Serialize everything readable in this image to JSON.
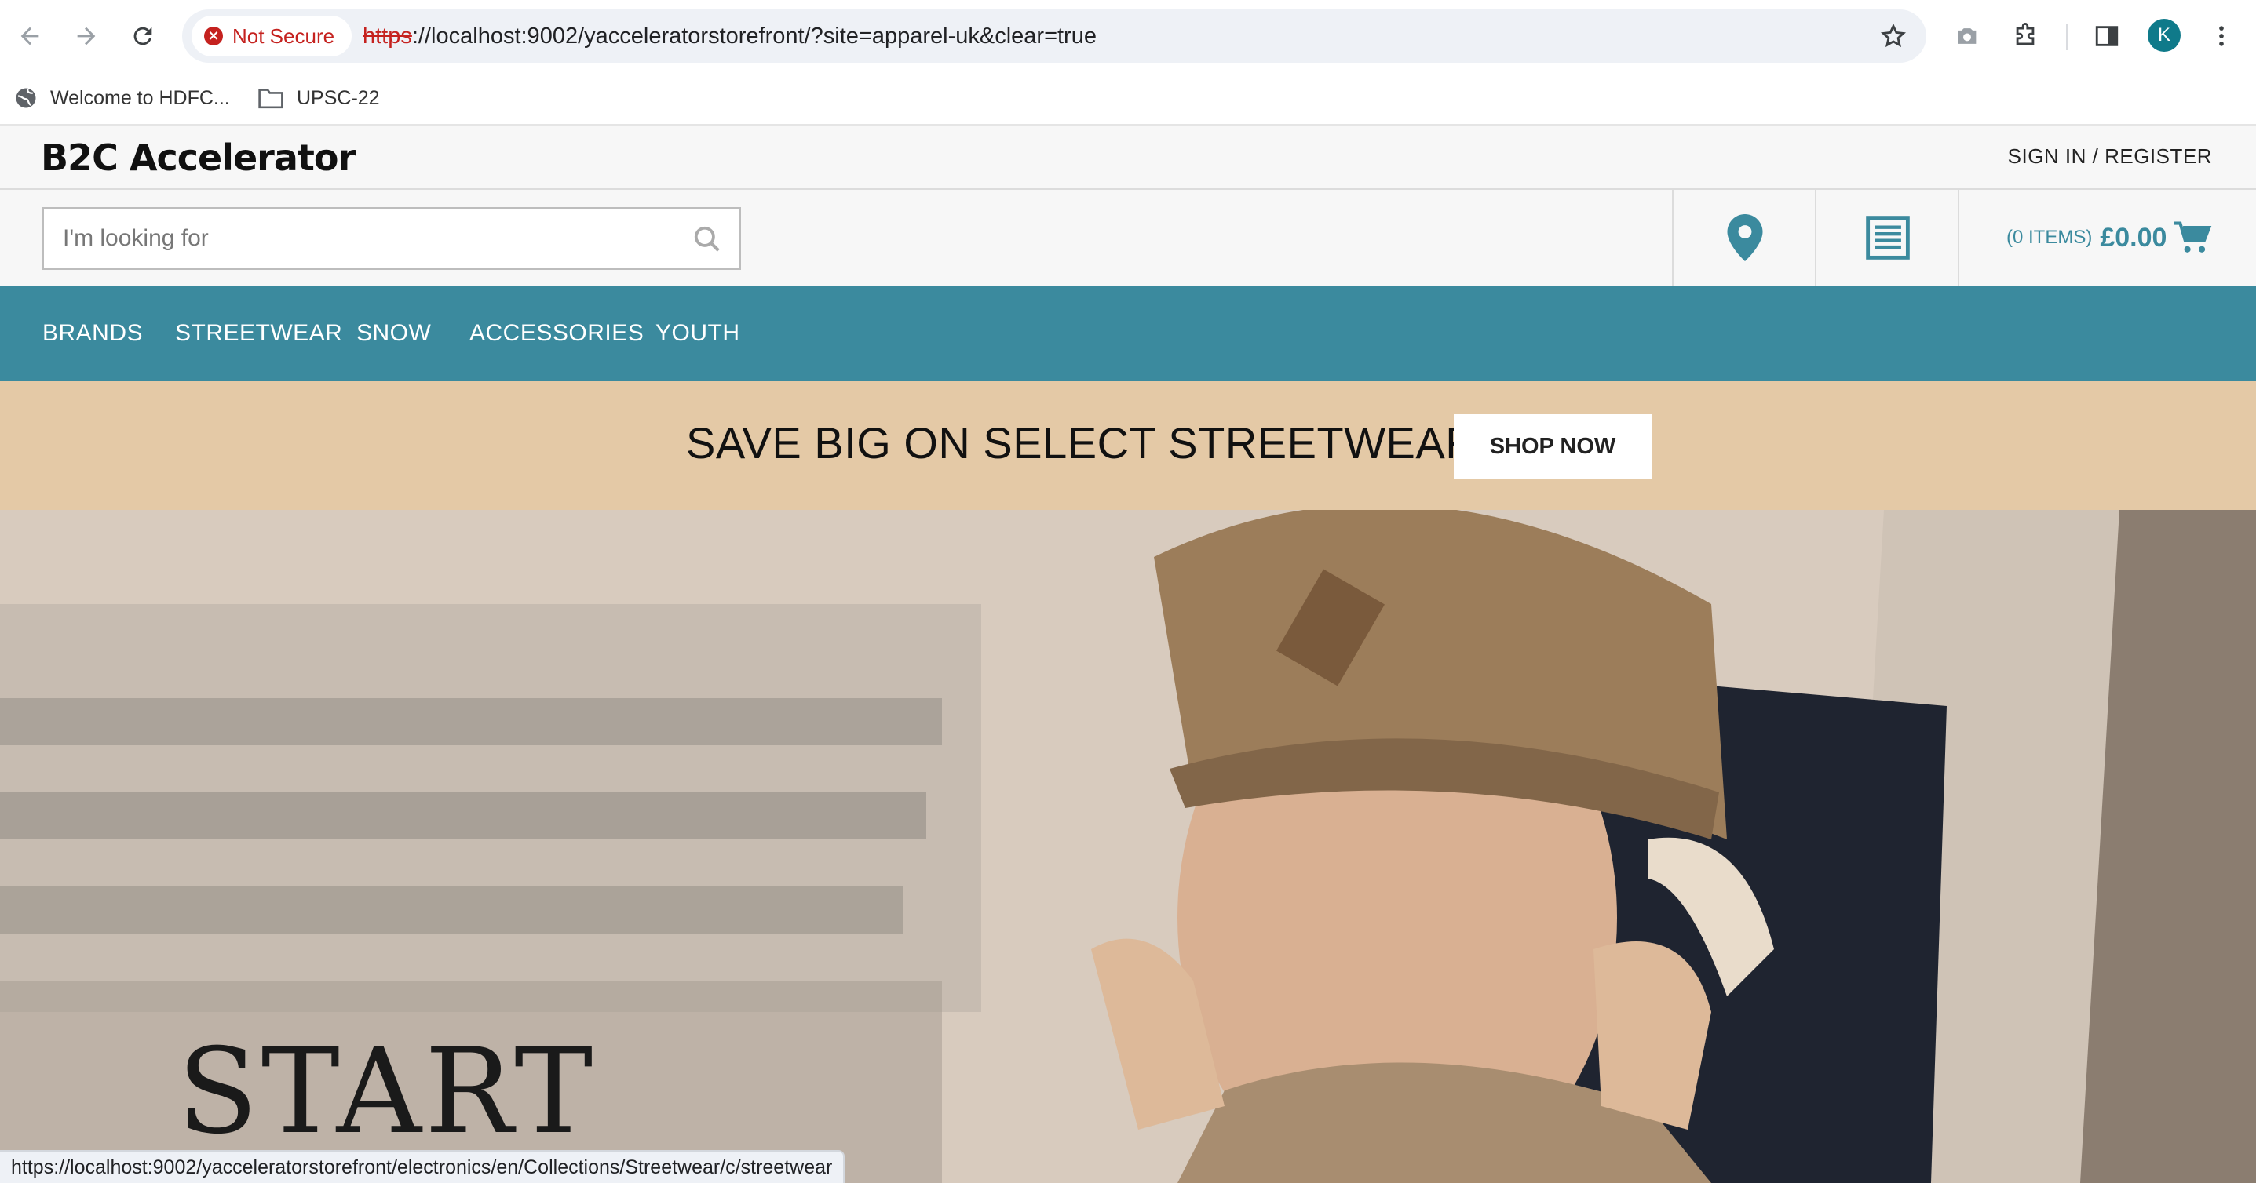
{
  "browser": {
    "security_label": "Not Secure",
    "url_scheme": "https",
    "url_rest": "://localhost:9002/yacceleratorstorefront/?site=apparel-uk&clear=true",
    "profile_initial": "K",
    "bookmarks": [
      {
        "label": "Welcome to HDFC...",
        "icon": "globe-icon"
      },
      {
        "label": "UPSC-22",
        "icon": "folder-icon"
      }
    ],
    "status_url": "https://localhost:9002/yacceleratorstorefront/electronics/en/Collections/Streetwear/c/streetwear"
  },
  "header": {
    "logo": "B2C Accelerator",
    "signin": "SIGN IN / REGISTER"
  },
  "search": {
    "placeholder": "I'm looking for"
  },
  "cart": {
    "items": "(0 ITEMS)",
    "total": "£0.00"
  },
  "nav": {
    "items": [
      "BRANDS",
      "STREETWEAR",
      "SNOW",
      "ACCESSORIES",
      "YOUTH"
    ]
  },
  "promo": {
    "text": "SAVE BIG ON SELECT STREETWEAR",
    "button": "SHOP NOW"
  },
  "hero": {
    "title": "START"
  },
  "colors": {
    "brand_teal": "#3b8a9e",
    "promo_bg": "#e4c9a6"
  }
}
